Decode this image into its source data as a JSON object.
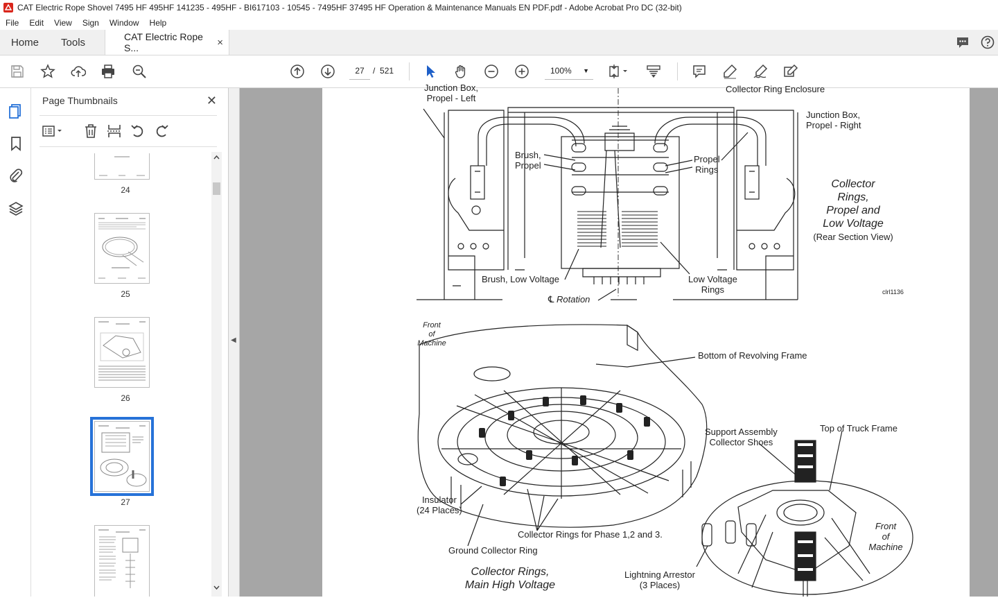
{
  "window": {
    "title": "CAT Electric Rope Shovel 7495 HF 495HF 141235 - 495HF - BI617103 - 10545 - 7495HF 37495 HF Operation & Maintenance Manuals EN PDF.pdf - Adobe Acrobat Pro DC (32-bit)"
  },
  "menu": [
    "File",
    "Edit",
    "View",
    "Sign",
    "Window",
    "Help"
  ],
  "tabs": {
    "home": "Home",
    "tools": "Tools",
    "document": "CAT Electric Rope S...",
    "close": "×"
  },
  "toolbar": {
    "page_current": "27",
    "page_sep": "/",
    "page_total": "521",
    "zoom": "100%"
  },
  "thumbnails": {
    "title": "Page Thumbnails",
    "close": "✕",
    "pages": [
      {
        "num": "24",
        "selected": false
      },
      {
        "num": "25",
        "selected": false
      },
      {
        "num": "26",
        "selected": false
      },
      {
        "num": "27",
        "selected": true
      },
      {
        "num": "",
        "selected": false
      }
    ]
  },
  "drawing": {
    "top": {
      "junction_left_1": "Junction Box,",
      "junction_left_2": "Propel - Left",
      "enclosure": "Collector Ring Enclosure",
      "junction_right_1": "Junction Box,",
      "junction_right_2": "Propel - Right",
      "brush_propel_1": "Brush,",
      "brush_propel_2": "Propel",
      "propel_rings_1": "Propel",
      "propel_rings_2": "Rings",
      "title_1": "Collector",
      "title_2": "Rings,",
      "title_3": "Propel and",
      "title_4": "Low Voltage",
      "title_5": "(Rear Section View)",
      "brush_low": "Brush, Low Voltage",
      "low_rings_1": "Low Voltage",
      "low_rings_2": "Rings",
      "rotation": "Rotation",
      "fig_id": "clrl1136"
    },
    "bottom": {
      "front_1": "Front",
      "front_2": "of",
      "front_3": "Machine",
      "revolving": "Bottom of Revolving Frame",
      "support_1": "Support Assembly",
      "support_2": "Collector Shoes",
      "truck": "Top of Truck Frame",
      "insulator_1": "Insulator",
      "insulator_2": "(24 Places)",
      "phase_rings": "Collector Rings for Phase 1,2 and 3.",
      "ground": "Ground Collector Ring",
      "front_r_1": "Front",
      "front_r_2": "of",
      "front_r_3": "Machine",
      "title_1": "Collector Rings,",
      "title_2": "Main High Voltage",
      "arrestor_1": "Lightning Arrestor",
      "arrestor_2": "(3 Places)"
    }
  }
}
